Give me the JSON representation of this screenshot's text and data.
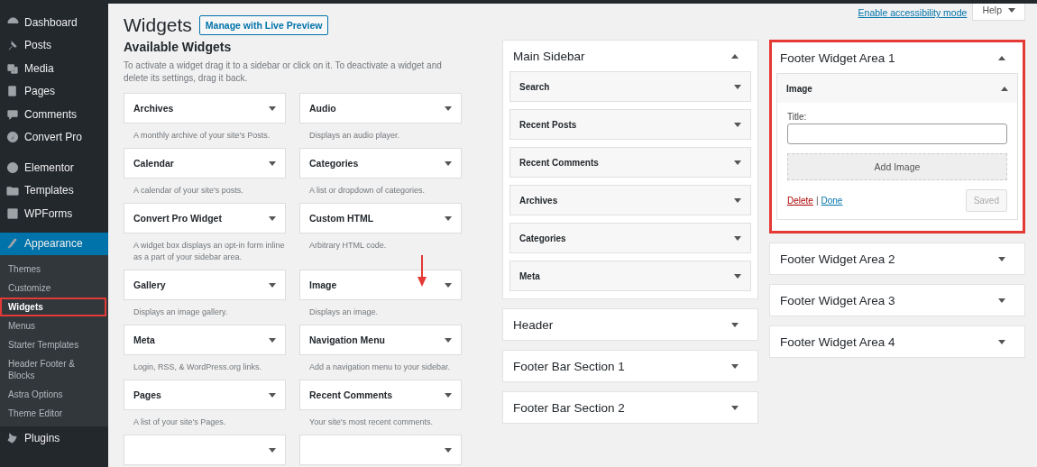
{
  "admin_menu": {
    "groups": [
      [
        {
          "label": "Dashboard",
          "selected": false
        },
        {
          "label": "Posts",
          "selected": false
        },
        {
          "label": "Media",
          "selected": false
        },
        {
          "label": "Pages",
          "selected": false
        },
        {
          "label": "Comments",
          "selected": false
        },
        {
          "label": "Convert Pro",
          "selected": false
        }
      ],
      [
        {
          "label": "Elementor",
          "selected": false
        },
        {
          "label": "Templates",
          "selected": false
        },
        {
          "label": "WPForms",
          "selected": false
        }
      ],
      [
        {
          "label": "Appearance",
          "selected": true,
          "children": [
            {
              "label": "Themes",
              "selected": false
            },
            {
              "label": "Customize",
              "selected": false
            },
            {
              "label": "Widgets",
              "selected": true
            },
            {
              "label": "Menus",
              "selected": false
            },
            {
              "label": "Starter Templates",
              "selected": false
            },
            {
              "label": "Header Footer & Blocks",
              "selected": false
            },
            {
              "label": "Astra Options",
              "selected": false
            },
            {
              "label": "Theme Editor",
              "selected": false
            }
          ]
        },
        {
          "label": "Plugins",
          "selected": false
        }
      ]
    ]
  },
  "header": {
    "title": "Widgets",
    "live_preview_button": "Manage with Live Preview",
    "accessibility_link": "Enable accessibility mode",
    "help_button": "Help"
  },
  "available_widgets": {
    "title": "Available Widgets",
    "description": "To activate a widget drag it to a sidebar or click on it. To deactivate a widget and delete its settings, drag it back.",
    "widgets": [
      {
        "name": "Archives",
        "description": "A monthly archive of your site's Posts."
      },
      {
        "name": "Audio",
        "description": "Displays an audio player."
      },
      {
        "name": "Calendar",
        "description": "A calendar of your site's posts."
      },
      {
        "name": "Categories",
        "description": "A list or dropdown of categories."
      },
      {
        "name": "Convert Pro Widget",
        "description": "A widget box displays an opt-in form inline as a part of your sidebar area."
      },
      {
        "name": "Custom HTML",
        "description": "Arbitrary HTML code."
      },
      {
        "name": "Gallery",
        "description": "Displays an image gallery."
      },
      {
        "name": "Image",
        "description": "Displays an image."
      },
      {
        "name": "Meta",
        "description": "Login, RSS, & WordPress.org links."
      },
      {
        "name": "Navigation Menu",
        "description": "Add a navigation menu to your sidebar."
      },
      {
        "name": "Pages",
        "description": "A list of your site's Pages."
      },
      {
        "name": "Recent Comments",
        "description": "Your site's most recent comments."
      }
    ]
  },
  "widget_areas": [
    [
      {
        "name": "Main Sidebar",
        "expanded": true,
        "highlighted": false,
        "widgets": [
          {
            "name": "Search",
            "expanded": false
          },
          {
            "name": "Recent Posts",
            "expanded": false
          },
          {
            "name": "Recent Comments",
            "expanded": false
          },
          {
            "name": "Archives",
            "expanded": false
          },
          {
            "name": "Categories",
            "expanded": false
          },
          {
            "name": "Meta",
            "expanded": false
          }
        ]
      },
      {
        "name": "Header",
        "expanded": false,
        "highlighted": false
      },
      {
        "name": "Footer Bar Section 1",
        "expanded": false,
        "highlighted": false
      },
      {
        "name": "Footer Bar Section 2",
        "expanded": false,
        "highlighted": false
      }
    ],
    [
      {
        "name": "Footer Widget Area 1",
        "expanded": true,
        "highlighted": true,
        "widgets": [
          {
            "name": "Image",
            "expanded": true,
            "form": {
              "title_label": "Title:",
              "add_button": "Add Image",
              "delete_link": "Delete",
              "separator": "|",
              "done_link": "Done",
              "saved_button": "Saved"
            }
          }
        ]
      },
      {
        "name": "Footer Widget Area 2",
        "expanded": false,
        "highlighted": false
      },
      {
        "name": "Footer Widget Area 3",
        "expanded": false,
        "highlighted": false
      },
      {
        "name": "Footer Widget Area 4",
        "expanded": false,
        "highlighted": false
      }
    ]
  ]
}
